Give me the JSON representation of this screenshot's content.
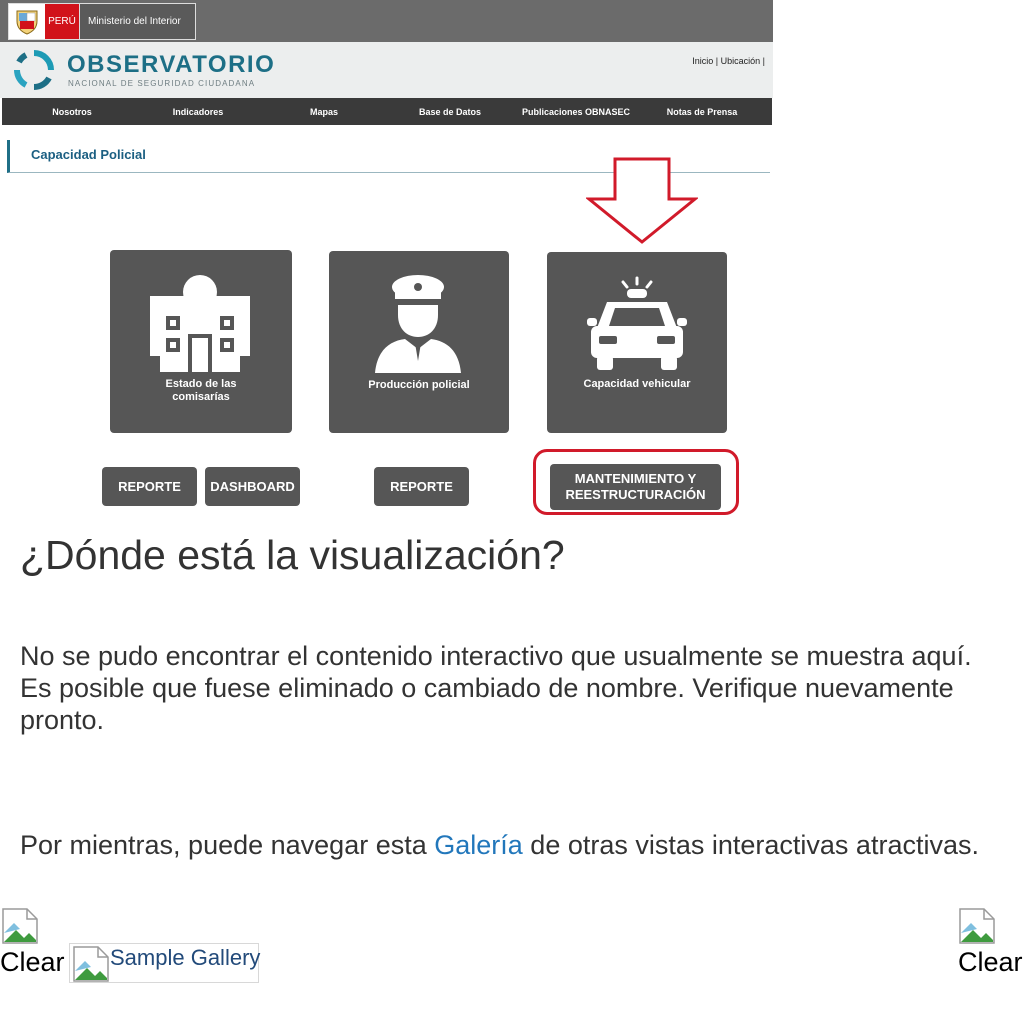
{
  "gov": {
    "country": "PERÚ",
    "ministry": "Ministerio del Interior"
  },
  "brand": {
    "title": "OBSERVATORIO",
    "subtitle": "NACIONAL DE SEGURIDAD CIUDADANA",
    "links": "Inicio | Ubicación |"
  },
  "nav": {
    "items": [
      "Nosotros",
      "Indicadores",
      "Mapas",
      "Base de Datos",
      "Publicaciones OBNASEC",
      "Notas de Prensa"
    ]
  },
  "section": {
    "title": "Capacidad Policial"
  },
  "cards": [
    {
      "label_line1": "Estado de las",
      "label_line2": "comisarías"
    },
    {
      "label_line1": "Producción policial"
    },
    {
      "label_line1": "Capacidad vehicular"
    }
  ],
  "buttons": {
    "reporte1": "REPORTE",
    "dashboard": "DASHBOARD",
    "reporte2": "REPORTE",
    "mant_line1": "MANTENIMIENTO Y",
    "mant_line2": "REESTRUCTURACIÓN"
  },
  "error": {
    "heading": "¿Dónde está la visualización?",
    "message": "No se pudo encontrar el contenido interactivo que usualmente se muestra aquí. Es posible que fuese eliminado o cambiado de nombre. Verifique nuevamente pronto.",
    "meanwhile_before": "Por mientras, puede navegar esta ",
    "meanwhile_link": "Galería",
    "meanwhile_after": " de otras vistas interactivas atractivas."
  },
  "footer": {
    "clear_left": "Clear",
    "gallery": "Sample Gallery",
    "clear_right": "Clear"
  },
  "colors": {
    "card_bg": "#565656",
    "brand_teal": "#1d6f86",
    "highlight_red": "#d11a2a",
    "link_blue": "#2277bb"
  }
}
